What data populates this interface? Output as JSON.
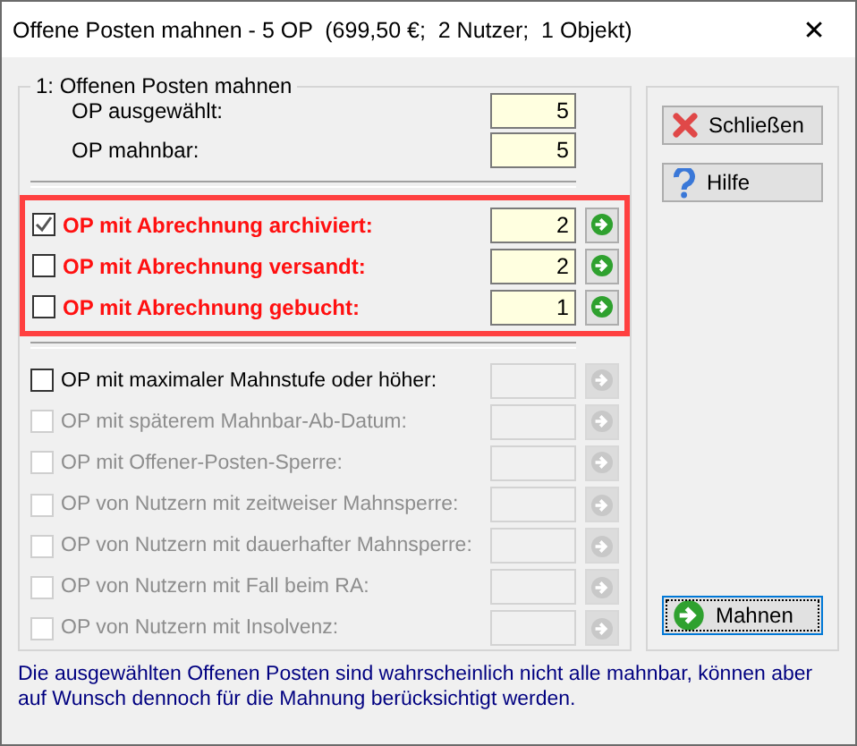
{
  "window": {
    "title": "Offene Posten mahnen - 5 OP  (699,50 €;  2 Nutzer;  1 Objekt)",
    "close": "✕"
  },
  "group": {
    "legend": "1: Offenen Posten mahnen",
    "counts": [
      {
        "label": "OP ausgewählt:",
        "value": "5"
      },
      {
        "label": "OP mahnbar:",
        "value": "5"
      }
    ],
    "highlighted": [
      {
        "label": "OP mit Abrechnung archiviert:",
        "checked": true,
        "disabled": false,
        "value": "2"
      },
      {
        "label": "OP mit Abrechnung versandt:",
        "checked": false,
        "disabled": false,
        "value": "2"
      },
      {
        "label": "OP mit Abrechnung gebucht:",
        "checked": false,
        "disabled": false,
        "value": "1"
      }
    ],
    "options": [
      {
        "label": "OP mit maximaler Mahnstufe oder höher:",
        "checked": false,
        "disabled": false
      },
      {
        "label": "OP mit späterem Mahnbar-Ab-Datum:",
        "checked": false,
        "disabled": true
      },
      {
        "label": "OP mit Offener-Posten-Sperre:",
        "checked": false,
        "disabled": true
      },
      {
        "label": "OP von Nutzern mit zeitweiser Mahnsperre:",
        "checked": false,
        "disabled": true
      },
      {
        "label": "OP von Nutzern mit dauerhafter Mahnsperre:",
        "checked": false,
        "disabled": true
      },
      {
        "label": "OP von Nutzern mit Fall beim RA:",
        "checked": false,
        "disabled": true
      },
      {
        "label": "OP von Nutzern mit Insolvenz:",
        "checked": false,
        "disabled": true
      }
    ]
  },
  "buttons": [
    {
      "kind": "close",
      "label": "Schließen",
      "focused": false
    },
    {
      "kind": "help",
      "label": "Hilfe",
      "focused": false
    },
    {
      "kind": "remind",
      "label": "Mahnen",
      "focused": true
    }
  ],
  "note": "Die ausgewählten Offenen Posten sind wahrscheinlich nicht alle mahnbar, können aber auf Wunsch dennoch für die Mahnung berücksichtigt werden."
}
